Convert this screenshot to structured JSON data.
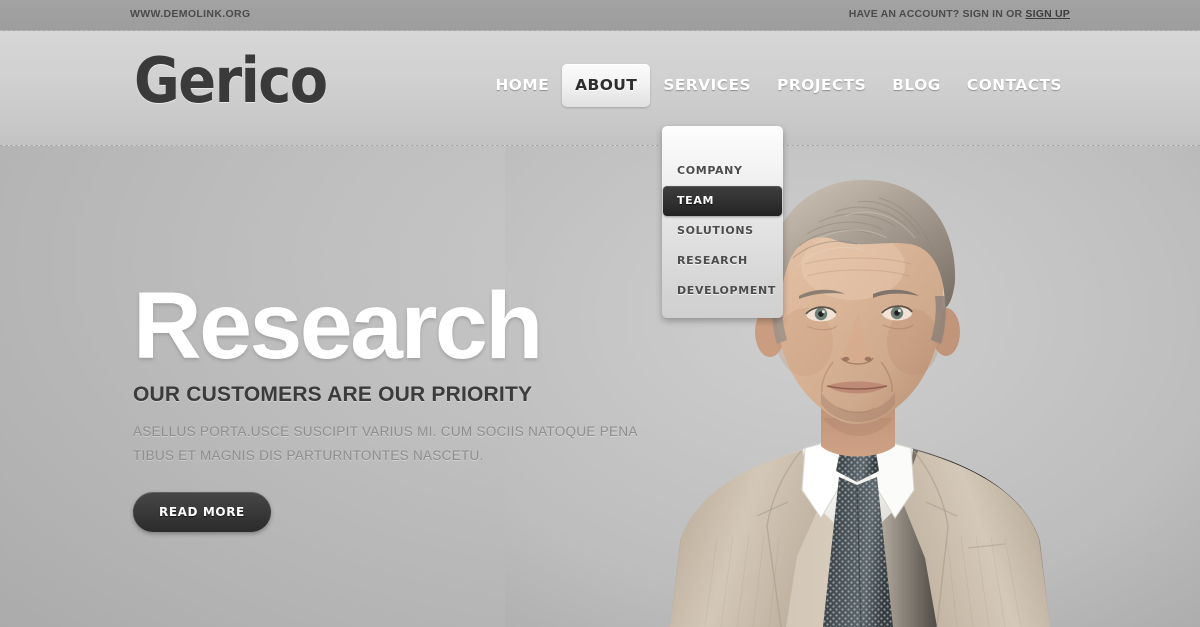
{
  "topbar": {
    "site_url": "WWW.DEMOLINK.ORG",
    "account_prefix": "HAVE AN ACCOUNT? SIGN IN OR ",
    "signup_label": "SIGN UP"
  },
  "header": {
    "logo": "Gerico",
    "nav": [
      {
        "label": "HOME",
        "active": false
      },
      {
        "label": "ABOUT",
        "active": true
      },
      {
        "label": "SERVICES",
        "active": false
      },
      {
        "label": "PROJECTS",
        "active": false
      },
      {
        "label": "BLOG",
        "active": false
      },
      {
        "label": "CONTACTS",
        "active": false
      }
    ]
  },
  "dropdown": {
    "parent": "ABOUT",
    "items": [
      {
        "label": "COMPANY",
        "selected": false
      },
      {
        "label": "TEAM",
        "selected": true
      },
      {
        "label": "SOLUTIONS",
        "selected": false
      },
      {
        "label": "RESEARCH",
        "selected": false
      },
      {
        "label": "DEVELOPMENT",
        "selected": false
      }
    ]
  },
  "hero": {
    "title": "Research",
    "subtitle": "OUR CUSTOMERS ARE OUR PRIORITY",
    "description": "ASELLUS PORTA.USCE SUSCIPIT VARIUS MI. CUM SOCIIS NATOQUE PENA TIBUS ET MAGNIS DIS PARTURNTONTES NASCETU.",
    "cta_label": "READ MORE",
    "image_alt": "businessman-portrait"
  },
  "colors": {
    "page_background": "#bebebe",
    "topbar": "#9d9d9d",
    "header_band": "#d1d1d1",
    "logo_text": "#3a3a3a",
    "nav_text": "#ffffff",
    "nav_active_text": "#2e2e2e",
    "dropdown_selected_bg": "#2b2b2b",
    "hero_title": "#ffffff",
    "hero_subtitle": "#3b3b3b",
    "hero_description": "#8e8e8e",
    "cta_bg": "#333333"
  }
}
